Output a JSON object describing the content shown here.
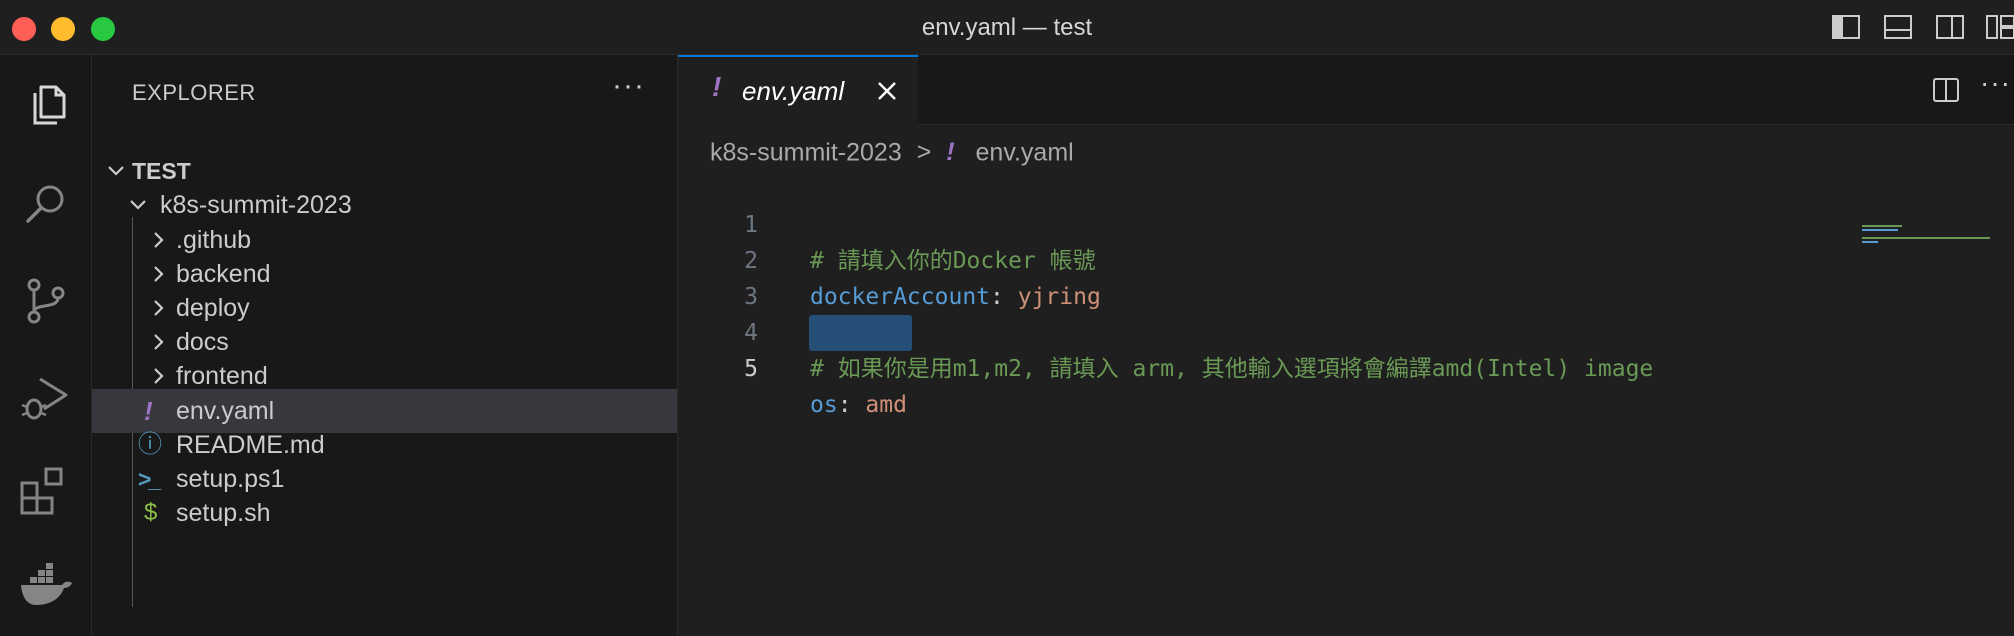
{
  "window": {
    "title": "env.yaml — test",
    "traffic_lights": {
      "close": "#ff5f57",
      "minimize": "#febc2e",
      "zoom": "#28c840"
    },
    "layout_icons": [
      "toggle-primary-sidebar-icon",
      "toggle-panel-icon",
      "toggle-secondary-sidebar-icon",
      "customize-layout-icon"
    ]
  },
  "activity_bar": {
    "items": [
      {
        "icon": "explorer-icon",
        "active": true
      },
      {
        "icon": "search-icon"
      },
      {
        "icon": "source-control-icon"
      },
      {
        "icon": "run-debug-icon"
      },
      {
        "icon": "extensions-icon"
      },
      {
        "icon": "docker-icon"
      }
    ]
  },
  "sidebar": {
    "title": "EXPLORER",
    "more_label": "···",
    "root": "TEST",
    "folder": "k8s-summit-2023",
    "items": [
      {
        "label": ".github",
        "type": "folder"
      },
      {
        "label": "backend",
        "type": "folder"
      },
      {
        "label": "deploy",
        "type": "folder"
      },
      {
        "label": "docs",
        "type": "folder"
      },
      {
        "label": "frontend",
        "type": "folder"
      },
      {
        "label": "env.yaml",
        "type": "yaml",
        "icon": "!",
        "selected": true
      },
      {
        "label": "README.md",
        "type": "markdown",
        "icon": "ⓘ"
      },
      {
        "label": "setup.ps1",
        "type": "powershell",
        "icon": ">_"
      },
      {
        "label": "setup.sh",
        "type": "shell",
        "icon": "$"
      }
    ]
  },
  "editor": {
    "tab": {
      "label": "env.yaml",
      "icon": "!"
    },
    "breadcrumb": {
      "folder": "k8s-summit-2023",
      "separator": ">",
      "file_icon": "!",
      "file": "env.yaml"
    },
    "lines": [
      {
        "number": "1",
        "comment": "# 請填入你的Docker 帳號"
      },
      {
        "number": "2",
        "key": "dockerAccount",
        "colon": ": ",
        "value": "yjring"
      },
      {
        "number": "3"
      },
      {
        "number": "4",
        "comment": "# 如果你是用m1,m2, 請填入 arm, 其他輸入選項將會編譯amd(Intel) image"
      },
      {
        "number": "5",
        "key": "os",
        "colon": ": ",
        "value": "amd",
        "active": true
      }
    ]
  },
  "colors": {
    "accent": "#0078d4",
    "comment": "#6a9955",
    "key": "#569cd6",
    "string": "#ce9178",
    "yaml_icon": "#a074c4",
    "selection": "#264f78"
  }
}
